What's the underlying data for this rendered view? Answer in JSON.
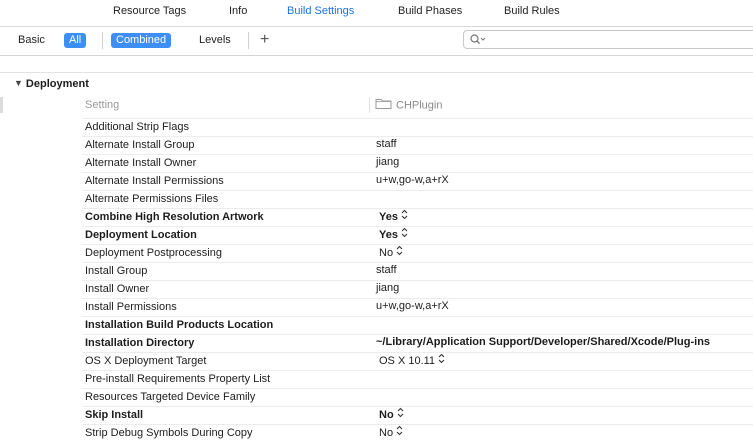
{
  "tabs": [
    {
      "label": "Resource Tags",
      "active": false
    },
    {
      "label": "Info",
      "active": false
    },
    {
      "label": "Build Settings",
      "active": true
    },
    {
      "label": "Build Phases",
      "active": false
    },
    {
      "label": "Build Rules",
      "active": false
    }
  ],
  "filter": {
    "basic": "Basic",
    "all": "All",
    "combined": "Combined",
    "levels": "Levels",
    "add": "+",
    "search_value": ""
  },
  "section": {
    "title": "Deployment",
    "setting_header": "Setting",
    "target_header": "CHPlugin"
  },
  "rows": [
    {
      "name": "Additional Strip Flags",
      "value": "",
      "bold": false,
      "stepper": false
    },
    {
      "name": "Alternate Install Group",
      "value": "staff",
      "bold": false,
      "stepper": false
    },
    {
      "name": "Alternate Install Owner",
      "value": "jiang",
      "bold": false,
      "stepper": false
    },
    {
      "name": "Alternate Install Permissions",
      "value": "u+w,go-w,a+rX",
      "bold": false,
      "stepper": false
    },
    {
      "name": "Alternate Permissions Files",
      "value": "",
      "bold": false,
      "stepper": false
    },
    {
      "name": "Combine High Resolution Artwork",
      "value": "Yes",
      "bold": true,
      "stepper": true
    },
    {
      "name": "Deployment Location",
      "value": "Yes",
      "bold": true,
      "stepper": true
    },
    {
      "name": "Deployment Postprocessing",
      "value": "No",
      "bold": false,
      "stepper": true
    },
    {
      "name": "Install Group",
      "value": "staff",
      "bold": false,
      "stepper": false
    },
    {
      "name": "Install Owner",
      "value": "jiang",
      "bold": false,
      "stepper": false
    },
    {
      "name": "Install Permissions",
      "value": "u+w,go-w,a+rX",
      "bold": false,
      "stepper": false
    },
    {
      "name": "Installation Build Products Location",
      "value": "",
      "bold": true,
      "stepper": false
    },
    {
      "name": "Installation Directory",
      "value": "~/Library/Application Support/Developer/Shared/Xcode/Plug-ins",
      "bold": true,
      "stepper": false
    },
    {
      "name": "OS X Deployment Target",
      "value": "OS X 10.11",
      "bold": false,
      "stepper": true
    },
    {
      "name": "Pre-install Requirements Property List",
      "value": "",
      "bold": false,
      "stepper": false
    },
    {
      "name": "Resources Targeted Device Family",
      "value": "",
      "bold": false,
      "stepper": false
    },
    {
      "name": "Skip Install",
      "value": "No",
      "bold": true,
      "stepper": true
    },
    {
      "name": "Strip Debug Symbols During Copy",
      "value": "No",
      "bold": false,
      "stepper": true
    }
  ]
}
